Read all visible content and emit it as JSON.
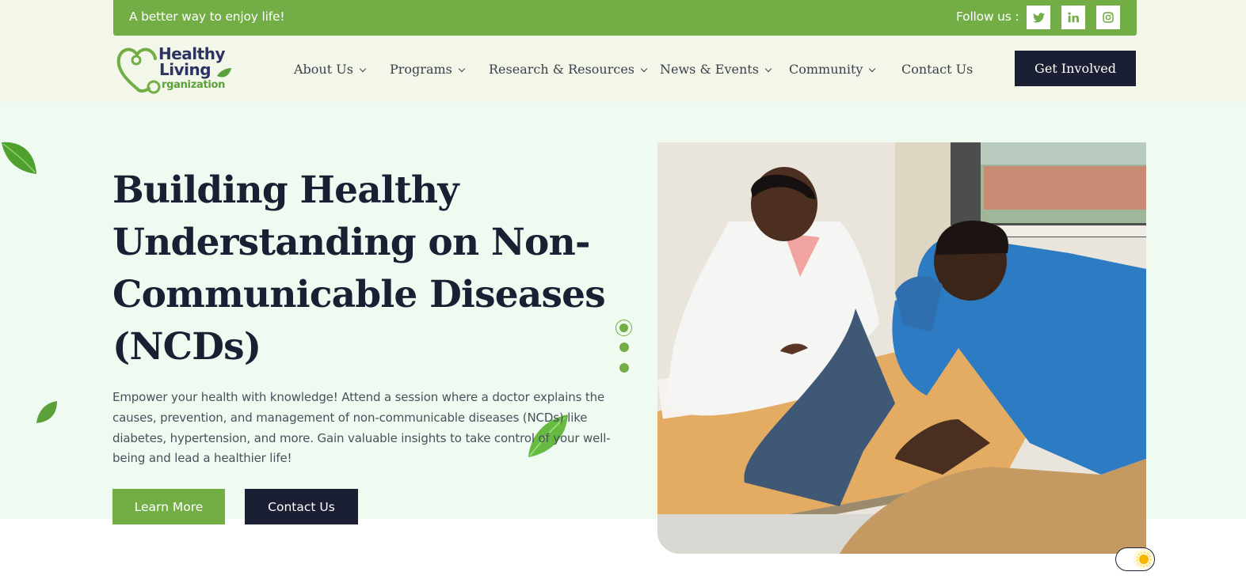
{
  "topbar": {
    "tagline": "A better way to enjoy life!",
    "follow_label": "Follow us :",
    "social": [
      {
        "icon": "twitter-icon"
      },
      {
        "icon": "linkedin-icon"
      },
      {
        "icon": "instagram-icon"
      }
    ]
  },
  "logo": {
    "line1": "Healthy",
    "line2": "Living",
    "line3": "rganization"
  },
  "nav": {
    "items": [
      {
        "label": "About Us",
        "dropdown": true
      },
      {
        "label": "Programs",
        "dropdown": true
      },
      {
        "label": "Research & Resources",
        "dropdown": true
      },
      {
        "label": "News & Events",
        "dropdown": true
      },
      {
        "label": "Community",
        "dropdown": true
      },
      {
        "label": "Contact Us",
        "dropdown": false
      }
    ],
    "cta_label": "Get Involved"
  },
  "hero": {
    "title": "Building Healthy Understanding on Non-Communicable Diseases (NCDs)",
    "description": "Empower your health with knowledge! Attend a session where a doctor explains the causes, prevention, and management of non-communicable diseases (NCDs) like diabetes, hypertension, and more. Gain valuable insights to take control of your well-being and lead a healthier life!",
    "learn_more_label": "Learn More",
    "contact_label": "Contact Us",
    "slides": {
      "count": 3,
      "active": 1
    }
  },
  "colors": {
    "accent_green": "#72ad45",
    "navy": "#1b1f33",
    "header_bg": "#f3f7ea",
    "hero_bg": "#effbf1"
  }
}
